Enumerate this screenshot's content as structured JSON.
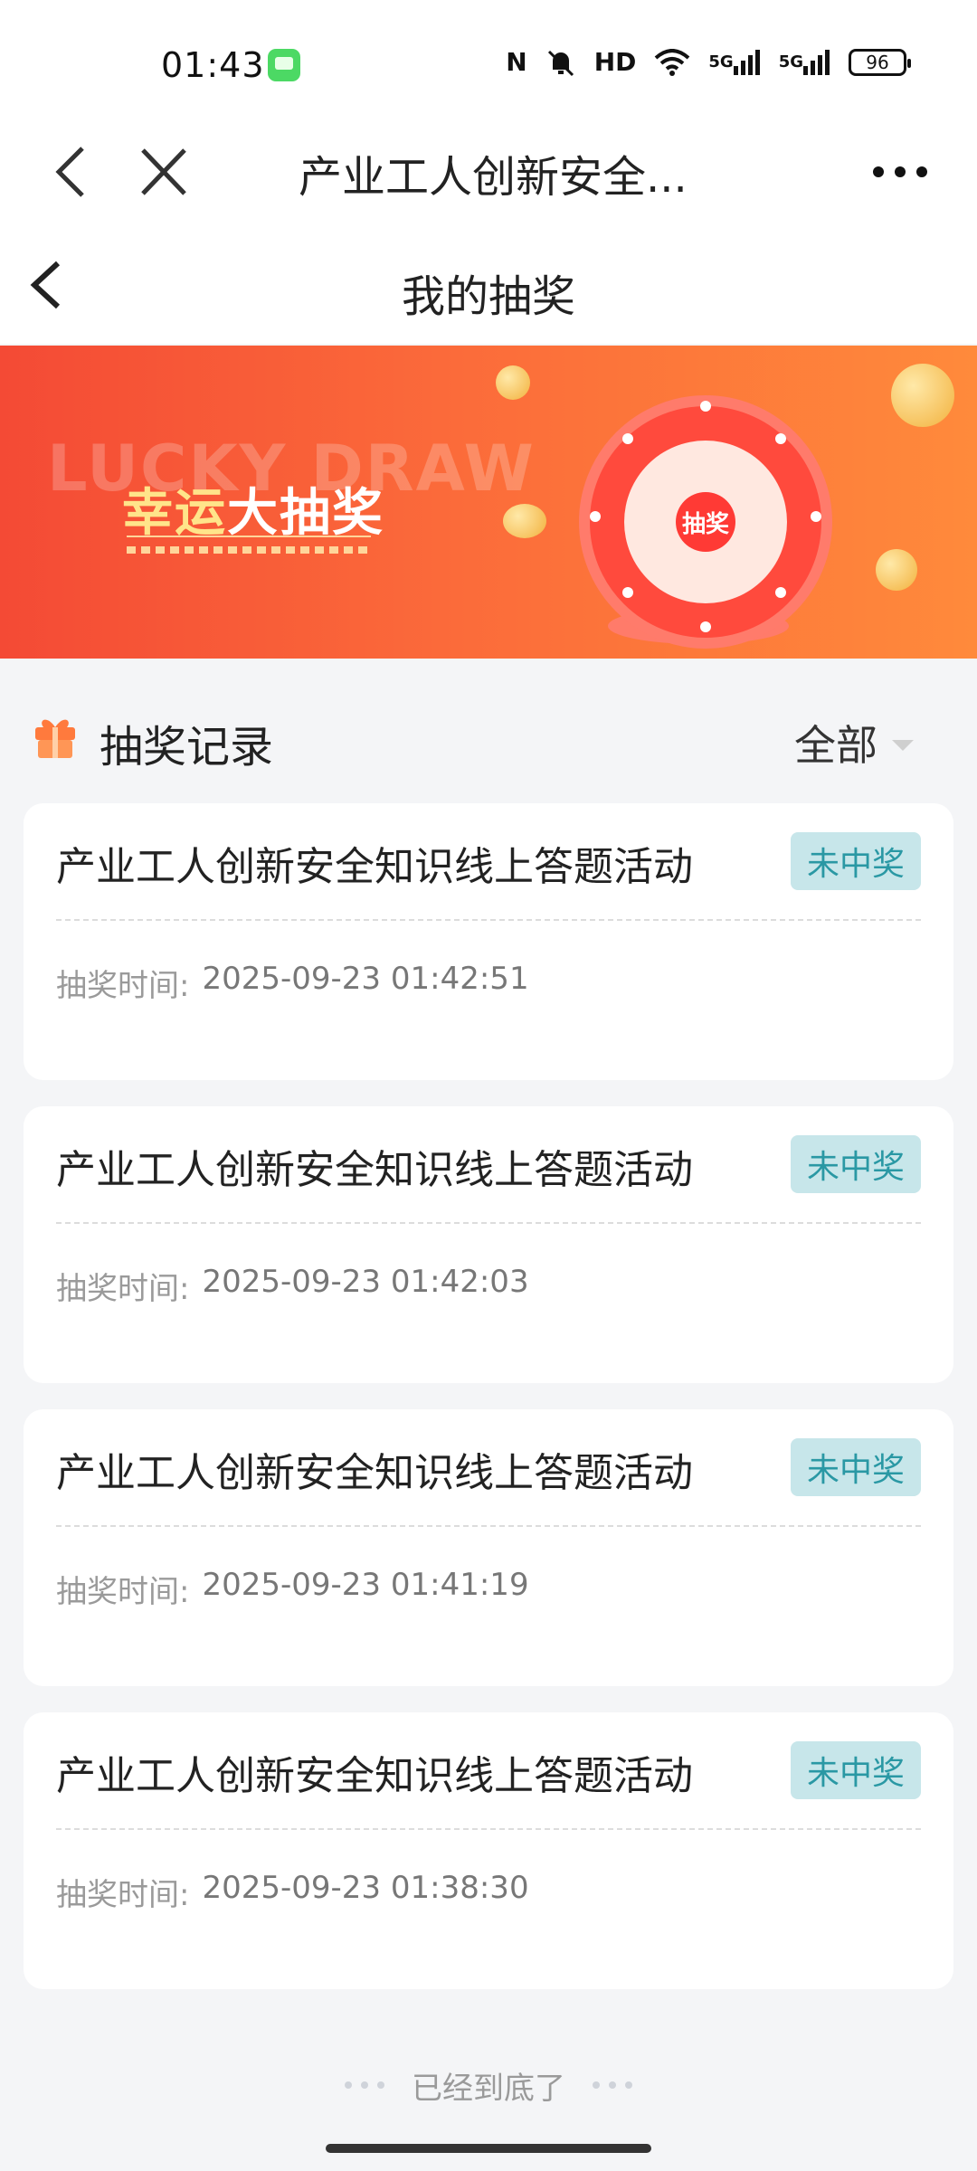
{
  "status_bar": {
    "time": "01:43",
    "nfc_label": "N",
    "hd_label": "HD",
    "signal_1": "5G",
    "signal_2": "5G",
    "battery": "96"
  },
  "browser_nav": {
    "title": "产业工人创新安全..."
  },
  "header": {
    "title": "我的抽奖"
  },
  "banner": {
    "watermark": "LUCKY DRAW",
    "title_part1": "幸运",
    "title_part2": "大抽奖",
    "wheel_center": "抽奖"
  },
  "records": {
    "title": "抽奖记录",
    "filter_selected": "全部"
  },
  "cards": [
    {
      "title": "产业工人创新安全知识线上答题活动",
      "status": "未中奖",
      "time_label": "抽奖时间:",
      "time": "2025-09-23 01:42:51"
    },
    {
      "title": "产业工人创新安全知识线上答题活动",
      "status": "未中奖",
      "time_label": "抽奖时间:",
      "time": "2025-09-23 01:42:03"
    },
    {
      "title": "产业工人创新安全知识线上答题活动",
      "status": "未中奖",
      "time_label": "抽奖时间:",
      "time": "2025-09-23 01:41:19"
    },
    {
      "title": "产业工人创新安全知识线上答题活动",
      "status": "未中奖",
      "time_label": "抽奖时间:",
      "time": "2025-09-23 01:38:30"
    }
  ],
  "footer": {
    "text": "已经到底了"
  },
  "colors": {
    "badge_bg": "#c7e6ea",
    "badge_text": "#2a98a4",
    "banner_start": "#f44a35",
    "banner_end": "#ff8a3b"
  }
}
